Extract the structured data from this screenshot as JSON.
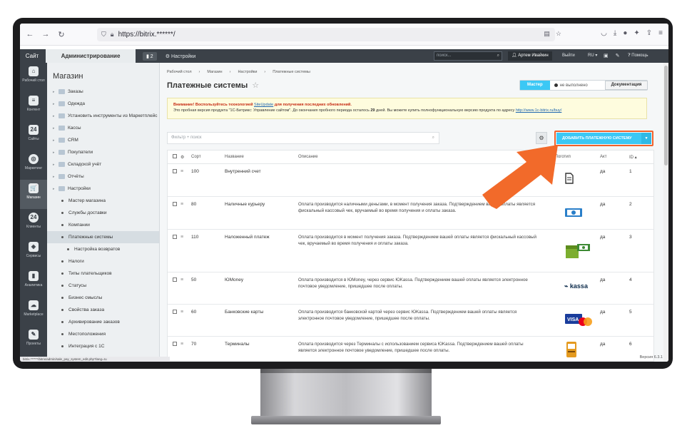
{
  "browser": {
    "url": "https://bitrix.******/",
    "nav": [
      "←",
      "→",
      "↻"
    ]
  },
  "toppanel": {
    "site_tab": "Сайт",
    "admin_tab": "Администрирование",
    "badge": "2",
    "settings": "Настройки",
    "search_placeholder": "поиск...",
    "user": "Артем Ивайкин",
    "exit": "Выйти",
    "lang": "RU",
    "help": "Помощь"
  },
  "iconbar": [
    {
      "label": "Рабочий стол",
      "glyph": "⌂"
    },
    {
      "label": "Контент",
      "glyph": "≡"
    },
    {
      "label": "Сайты",
      "glyph": "24"
    },
    {
      "label": "Маркетинг",
      "glyph": "◎"
    },
    {
      "label": "Магазин",
      "glyph": "🛒"
    },
    {
      "label": "Клиенты",
      "glyph": "24"
    },
    {
      "label": "Сервисы",
      "glyph": "◈"
    },
    {
      "label": "Аналитика",
      "glyph": "▮"
    },
    {
      "label": "Marketplace",
      "glyph": "☁"
    },
    {
      "label": "Проекты",
      "glyph": "✎"
    }
  ],
  "menu": {
    "title": "Магазин",
    "items": [
      {
        "label": "Заказы",
        "level": 0
      },
      {
        "label": "Одежда",
        "level": 0
      },
      {
        "label": "Установить инструменты из Маркетплейс",
        "level": 0
      },
      {
        "label": "Кассы",
        "level": 0
      },
      {
        "label": "CRM",
        "level": 0
      },
      {
        "label": "Покупатели",
        "level": 0
      },
      {
        "label": "Складской учёт",
        "level": 0
      },
      {
        "label": "Отчёты",
        "level": 0
      },
      {
        "label": "Настройки",
        "level": 0
      },
      {
        "label": "Мастер магазина",
        "level": 1
      },
      {
        "label": "Службы доставки",
        "level": 1
      },
      {
        "label": "Компании",
        "level": 1
      },
      {
        "label": "Платежные системы",
        "level": 1
      },
      {
        "label": "Настройка возвратов",
        "level": 2
      },
      {
        "label": "Налоги",
        "level": 1
      },
      {
        "label": "Типы плательщиков",
        "level": 1
      },
      {
        "label": "Статусы",
        "level": 1
      },
      {
        "label": "Бизнес смыслы",
        "level": 1
      },
      {
        "label": "Свойства заказа",
        "level": 1
      },
      {
        "label": "Архивирование заказов",
        "level": 1
      },
      {
        "label": "Местоположения",
        "level": 1
      },
      {
        "label": "Интеграция с 1С",
        "level": 1
      }
    ]
  },
  "breadcrumbs": [
    "Рабочий стол",
    "›",
    "Магазин",
    "›",
    "Настройки",
    "›",
    "Платежные системы"
  ],
  "page": {
    "title": "Платежные системы",
    "mode_master": "Мастер",
    "mode_status": "не выполнено",
    "doc_button": "Документация"
  },
  "notice": {
    "attention": "Внимание! Воспользуйтесь технологией",
    "link": "SiteUpdate",
    "attention_tail": "для получения последних обновлений.",
    "trial_prefix": "Это пробная версия продукта \"1С-Битрикс: Управление сайтом\". До окончания пробного периода осталось",
    "days": "29",
    "trial_suffix": "дней. Вы можете купить полнофункциональную версию продукта по адресу",
    "buy_link": "http://www.1c-bitrix.ru/buy/"
  },
  "toolbar": {
    "filter_placeholder": "Фильтр + поиск",
    "add_button": "ДОБАВИТЬ ПЛАТЕЖНУЮ СИСТЕМУ"
  },
  "table": {
    "headers": {
      "sort": "Сорт",
      "name": "Название",
      "desc": "Описание",
      "logo": "Логотип",
      "act": "Акт",
      "id": "ID"
    },
    "rows": [
      {
        "sort": "100",
        "name": "Внутренний счет",
        "desc": "",
        "act": "да",
        "id": "1",
        "logo": "doc-icon"
      },
      {
        "sort": "80",
        "name": "Наличные курьеру",
        "desc": "Оплата производится наличными деньгами, в момент получения заказа. Подтверждением вашей оплаты является фискальный кассовый чек, вручаемый во время получения и оплаты заказа.",
        "act": "да",
        "id": "2",
        "logo": "cash-icon"
      },
      {
        "sort": "110",
        "name": "Наложенный платеж",
        "desc": "Оплата производится в момент получения заказа. Подтверждением вашей оплаты является фискальный кассовый чек, вручаемый во время получения и оплаты заказа.",
        "act": "да",
        "id": "3",
        "logo": "cod-icon"
      },
      {
        "sort": "50",
        "name": "ЮMoney",
        "desc": "Оплата производится в ЮMoney, через сервис ЮKassa. Подтверждением вашей оплаты является электронное почтовое уведомление, пришедшее после оплаты.",
        "act": "да",
        "id": "4",
        "logo": "kassa"
      },
      {
        "sort": "60",
        "name": "Банковские карты",
        "desc": "Оплата производится банковской картой через сервис ЮKassa. Подтверждением вашей оплаты является электронное почтовое уведомление, пришедшее после оплаты.",
        "act": "да",
        "id": "5",
        "logo": "cards-icon"
      },
      {
        "sort": "70",
        "name": "Терминалы",
        "desc": "Оплата производится через Терминалы с использованием сервиса ЮKassa. Подтверждением вашей оплаты является электронное почтовое уведомление, пришедшее после оплаты.",
        "act": "да",
        "id": "6",
        "logo": "terminal-icon"
      }
    ]
  },
  "footer": {
    "version": "Версия 6.3.1",
    "status_url": "bitrix.******/bitrix/admin/sale_pay_system_edit.php?lang=ru"
  },
  "colors": {
    "accent": "#3bc8f5",
    "arrow": "#f26a2a",
    "panel": "#3b4148"
  }
}
